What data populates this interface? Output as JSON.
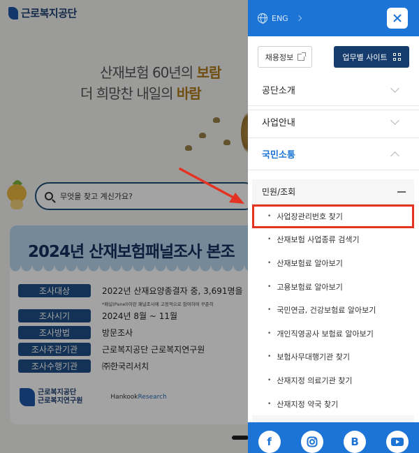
{
  "background": {
    "logo_text": "근로복지공단",
    "banner_line1_prefix": "산재보험 60년의 ",
    "banner_line1_em": "보람",
    "banner_line2_prefix": "더 희망찬 내일의 ",
    "banner_line2_em": "바람",
    "search_placeholder": "무엇을 찾고 계신가요?",
    "poster": {
      "title": "2024년 산재보험패널조사 본조",
      "rows": [
        {
          "tag": "조사대상",
          "value": "2022년 산재요양종결자 중, 3,691명을"
        },
        {
          "tag": "조사시기",
          "value": "2024년 8월 ~ 11월"
        },
        {
          "tag": "조사방법",
          "value": "방문조사"
        },
        {
          "tag": "조사주관기관",
          "value": "근로복지공단 근로복지연구원"
        },
        {
          "tag": "조사수행기관",
          "value": "㈜한국리서치"
        }
      ],
      "note": "*패널(Panel)이란 패널조사에 고정적으로 참여하여 꾸준히",
      "footer_logo_line1": "근로복지공단",
      "footer_logo_line2": "근로복지연구원",
      "footer_hankook_a": "Hankook",
      "footer_hankook_b": "Research"
    }
  },
  "drawer": {
    "language": "ENG",
    "job_info_label": "채용정보",
    "work_sites_label": "업무별 사이트",
    "menus": [
      {
        "label": "공단소개",
        "expanded": false
      },
      {
        "label": "사업안내",
        "expanded": false
      },
      {
        "label": "국민소통",
        "expanded": true
      }
    ],
    "submenu_title": "민원/조회",
    "submenu_items": [
      "사업장관리번호 찾기",
      "산재보험 사업종류 검색기",
      "산재보험료 알아보기",
      "고용보험료 알아보기",
      "국민연금, 건강보험료 알아보기",
      "개인직영공사 보험료 알아보기",
      "보험사무대행기관 찾기",
      "산재지정 의료기관 찾기",
      "산재지정 약국 찾기"
    ],
    "highlighted_index": 0,
    "social_icons": [
      "facebook-icon",
      "instagram-icon",
      "blog-icon",
      "youtube-icon"
    ]
  },
  "colors": {
    "drawer_header": "#1c74d6",
    "active_menu": "#1c74d6",
    "work_button": "#163c6e",
    "highlight_box": "#e53323",
    "annotation_arrow": "#e53323"
  }
}
